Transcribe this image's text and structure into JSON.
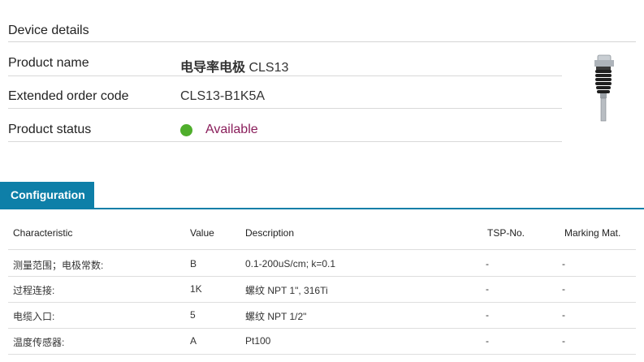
{
  "device_details": {
    "title": "Device details",
    "product_name_label": "Product name",
    "product_name_bold": "电导率电极",
    "product_name_code": "CLS13",
    "order_code_label": "Extended order code",
    "order_code_value": "CLS13-B1K5A",
    "status_label": "Product status",
    "status_value": "Available",
    "status_color": "#4fae2c"
  },
  "tabs": [
    {
      "label": "Configuration"
    }
  ],
  "table": {
    "headers": [
      "Characteristic",
      "Value",
      "Description",
      "TSP-No.",
      "Marking Mat."
    ],
    "rows": [
      {
        "characteristic": "测量范围；电极常数:",
        "value": "B",
        "description": "0.1-200uS/cm; k=0.1",
        "tsp": "-",
        "marking": "-"
      },
      {
        "characteristic": "过程连接:",
        "value": "1K",
        "description": "螺纹 NPT 1\", 316Ti",
        "tsp": "-",
        "marking": "-"
      },
      {
        "characteristic": "电缆入口:",
        "value": "5",
        "description": "螺纹 NPT 1/2\"",
        "tsp": "-",
        "marking": "-"
      },
      {
        "characteristic": "温度传感器:",
        "value": "A",
        "description": "Pt100",
        "tsp": "-",
        "marking": "-"
      }
    ]
  },
  "colors": {
    "accent": "#0e7fa8",
    "status_text": "#8a1e5b"
  }
}
